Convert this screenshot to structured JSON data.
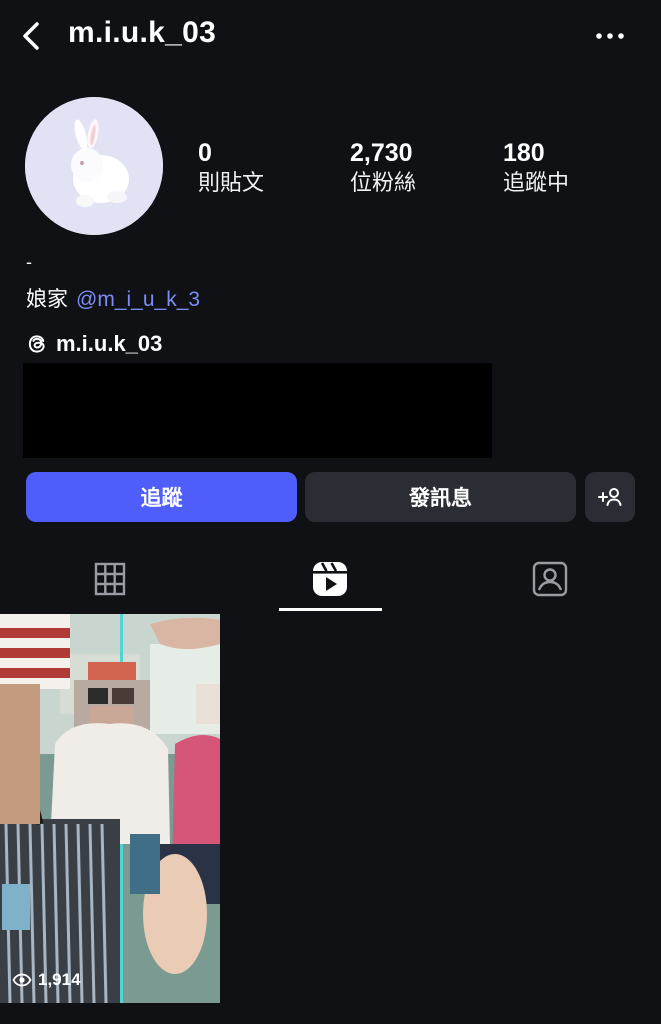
{
  "header": {
    "username": "m.i.u.k_03",
    "back_icon": "chevron-left-icon",
    "more_icon": "more-horizontal-icon"
  },
  "stats": [
    {
      "value": "0",
      "label": "則貼文"
    },
    {
      "value": "2,730",
      "label": "位粉絲"
    },
    {
      "value": "180",
      "label": "追蹤中"
    }
  ],
  "bio": {
    "dash": "-",
    "text": "娘家",
    "mention": "@m_i_u_k_3"
  },
  "threads": {
    "handle": "m.i.u.k_03",
    "icon": "threads-icon"
  },
  "buttons": {
    "follow": "追蹤",
    "message": "發訊息",
    "add_user_icon": "add-user-icon"
  },
  "tabs": [
    {
      "id": "grid",
      "icon": "grid-icon"
    },
    {
      "id": "reels",
      "icon": "reels-icon",
      "selected": true
    },
    {
      "id": "tagged",
      "icon": "tagged-icon"
    }
  ],
  "posts": [
    {
      "type": "reel",
      "views": "1,914"
    }
  ],
  "colors": {
    "background": "#0f1115",
    "accent": "#4f5efb",
    "mention": "#7b8cf5",
    "secondary_button": "#2a2d33"
  }
}
